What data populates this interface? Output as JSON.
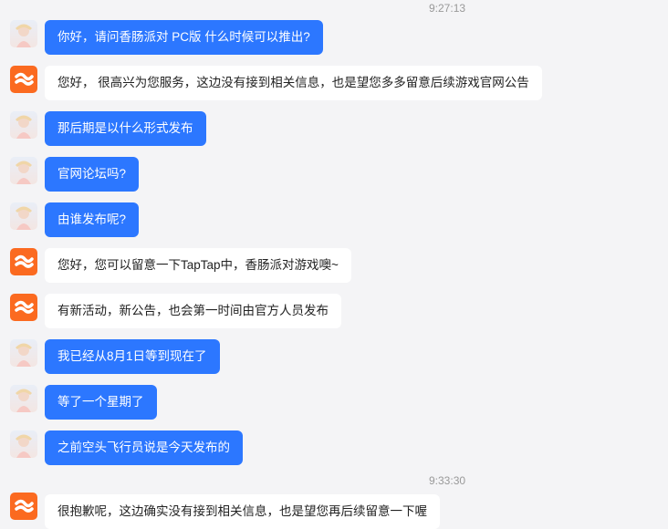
{
  "timestamps": [
    "9:27:13",
    "9:33:30"
  ],
  "messages": [
    {
      "sender": "user",
      "text": "你好，请问香肠派对 PC版 什么时候可以推出?"
    },
    {
      "sender": "bot",
      "text": "您好， 很高兴为您服务，这边没有接到相关信息，也是望您多多留意后续游戏官网公告"
    },
    {
      "sender": "user",
      "text": "那后期是以什么形式发布"
    },
    {
      "sender": "user",
      "text": "官网论坛吗?"
    },
    {
      "sender": "user",
      "text": "由谁发布呢?"
    },
    {
      "sender": "bot",
      "text": "您好，您可以留意一下TapTap中，香肠派对游戏噢~"
    },
    {
      "sender": "bot",
      "text": "有新活动，新公告，也会第一时间由官方人员发布"
    },
    {
      "sender": "user",
      "text": "我已经从8月1日等到现在了"
    },
    {
      "sender": "user",
      "text": "等了一个星期了"
    },
    {
      "sender": "user",
      "text": "之前空头飞行员说是今天发布的"
    },
    {
      "sender": "bot",
      "text": "很抱歉呢，这边确实没有接到相关信息，也是望您再后续留意一下喔"
    }
  ],
  "colors": {
    "user_bubble": "#2c77ff",
    "bot_bubble": "#ffffff",
    "bot_avatar": "#fb6a20",
    "background": "#f4f4f6"
  },
  "icons": {
    "bot_avatar": "sausage-logo-icon",
    "user_avatar": "user-avatar-icon"
  }
}
